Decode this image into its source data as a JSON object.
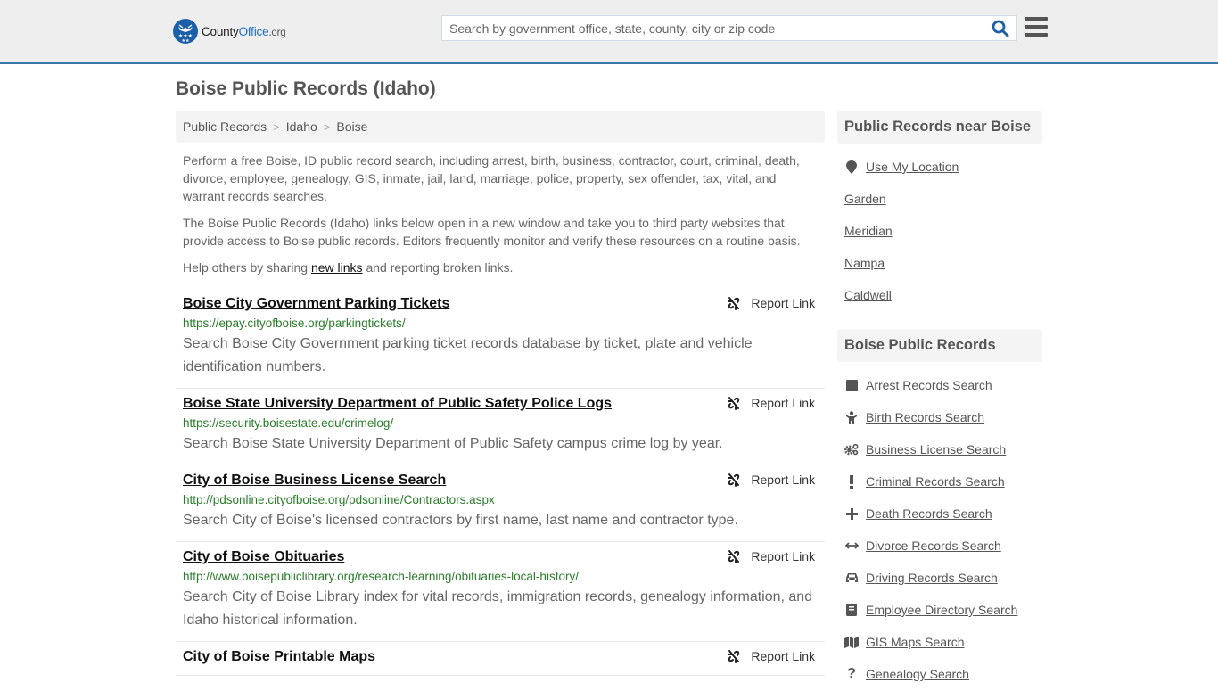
{
  "header": {
    "logo": {
      "county": "County",
      "office": "Office",
      "org": ".org"
    },
    "search": {
      "placeholder": "Search by government office, state, county, city or zip code",
      "value": ""
    },
    "colors": {
      "accent": "#3a77aa",
      "brand": "#1b5fa8"
    }
  },
  "main": {
    "title": "Boise Public Records (Idaho)",
    "breadcrumb": [
      {
        "label": "Public Records"
      },
      {
        "label": "Idaho"
      },
      {
        "label": "Boise"
      }
    ],
    "breadcrumb_separator": ">",
    "intro": {
      "p1": "Perform a free Boise, ID public record search, including arrest, birth, business, contractor, court, criminal, death, divorce, employee, genealogy, GIS, inmate, jail, land, marriage, police, property, sex offender, tax, vital, and warrant records searches.",
      "p2": "The Boise Public Records (Idaho) links below open in a new window and take you to third party websites that provide access to Boise public records. Editors frequently monitor and verify these resources on a routine basis.",
      "p3_before": "Help others by sharing ",
      "p3_link": "new links",
      "p3_after": " and reporting broken links."
    },
    "report_label": "Report Link",
    "listings": [
      {
        "title": "Boise City Government Parking Tickets",
        "url": "https://epay.cityofboise.org/parkingtickets/",
        "description": "Search Boise City Government parking ticket records database by ticket, plate and vehicle identification numbers."
      },
      {
        "title": "Boise State University Department of Public Safety Police Logs",
        "url": "https://security.boisestate.edu/crimelog/",
        "description": "Search Boise State University Department of Public Safety campus crime log by year."
      },
      {
        "title": "City of Boise Business License Search",
        "url": "http://pdsonline.cityofboise.org/pdsonline/Contractors.aspx",
        "description": "Search City of Boise's licensed contractors by first name, last name and contractor type."
      },
      {
        "title": "City of Boise Obituaries",
        "url": "http://www.boisepubliclibrary.org/research-learning/obituaries-local-history/",
        "description": "Search City of Boise Library index for vital records, immigration records, genealogy information, and Idaho historical information."
      },
      {
        "title": "City of Boise Printable Maps",
        "url": "",
        "description": ""
      }
    ]
  },
  "sidebar": {
    "nearby": {
      "heading": "Public Records near Boise",
      "use_location": {
        "label": "Use My Location",
        "icon": "map-marker-icon"
      },
      "places": [
        {
          "label": "Garden"
        },
        {
          "label": "Meridian"
        },
        {
          "label": "Nampa"
        },
        {
          "label": "Caldwell"
        }
      ]
    },
    "records": {
      "heading": "Boise Public Records",
      "items": [
        {
          "label": "Arrest Records Search",
          "icon": "square-icon"
        },
        {
          "label": "Birth Records Search",
          "icon": "child-icon"
        },
        {
          "label": "Business License Search",
          "icon": "gears-icon"
        },
        {
          "label": "Criminal Records Search",
          "icon": "exclamation-icon"
        },
        {
          "label": "Death Records Search",
          "icon": "plus-icon"
        },
        {
          "label": "Divorce Records Search",
          "icon": "arrows-horizontal-icon"
        },
        {
          "label": "Driving Records Search",
          "icon": "car-icon"
        },
        {
          "label": "Employee Directory Search",
          "icon": "book-icon"
        },
        {
          "label": "GIS Maps Search",
          "icon": "map-icon"
        },
        {
          "label": "Genealogy Search",
          "icon": "question-icon"
        }
      ]
    }
  }
}
